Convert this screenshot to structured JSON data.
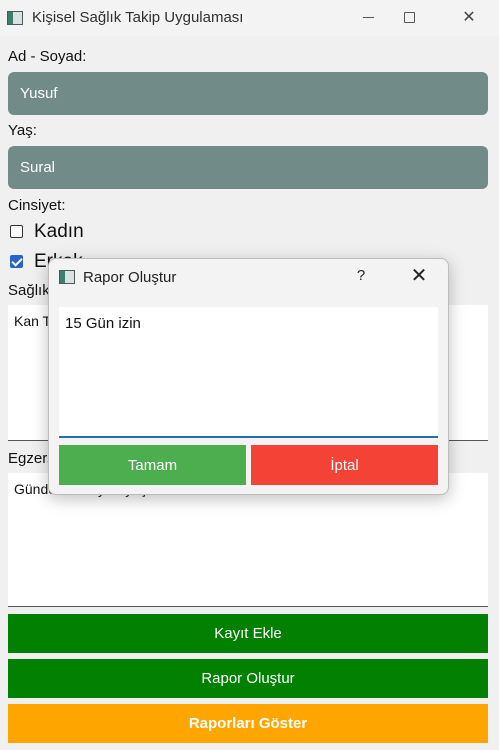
{
  "window": {
    "title": "Kişisel Sağlık Takip Uygulaması",
    "icon": "app-icon"
  },
  "form": {
    "name_label": "Ad - Soyad:",
    "name_value": "Yusuf",
    "age_label": "Yaş:",
    "age_value": "Sural",
    "gender_label": "Cinsiyet:",
    "gender_options": [
      {
        "label": "Kadın",
        "checked": false
      },
      {
        "label": "Erkek",
        "checked": true
      }
    ],
    "health_label": "Sağlık Durumu:",
    "health_value": "Kan Tahlili",
    "exercise_label": "Egzersiz:",
    "exercise_value": "Günde 30 dk yürüyüş"
  },
  "buttons": {
    "add_record": "Kayıt Ekle",
    "create_report": "Rapor Oluştur",
    "show_reports": "Raporları Göster"
  },
  "colors": {
    "field_bg": "#718b89",
    "green": "#018001",
    "orange": "#ffa500",
    "ok": "#4cae4f",
    "cancel": "#f44336"
  },
  "dialog": {
    "title": "Rapor Oluştur",
    "help": "?",
    "close": "✕",
    "text_value": "15 Gün izin",
    "ok_label": "Tamam",
    "cancel_label": "İptal"
  }
}
